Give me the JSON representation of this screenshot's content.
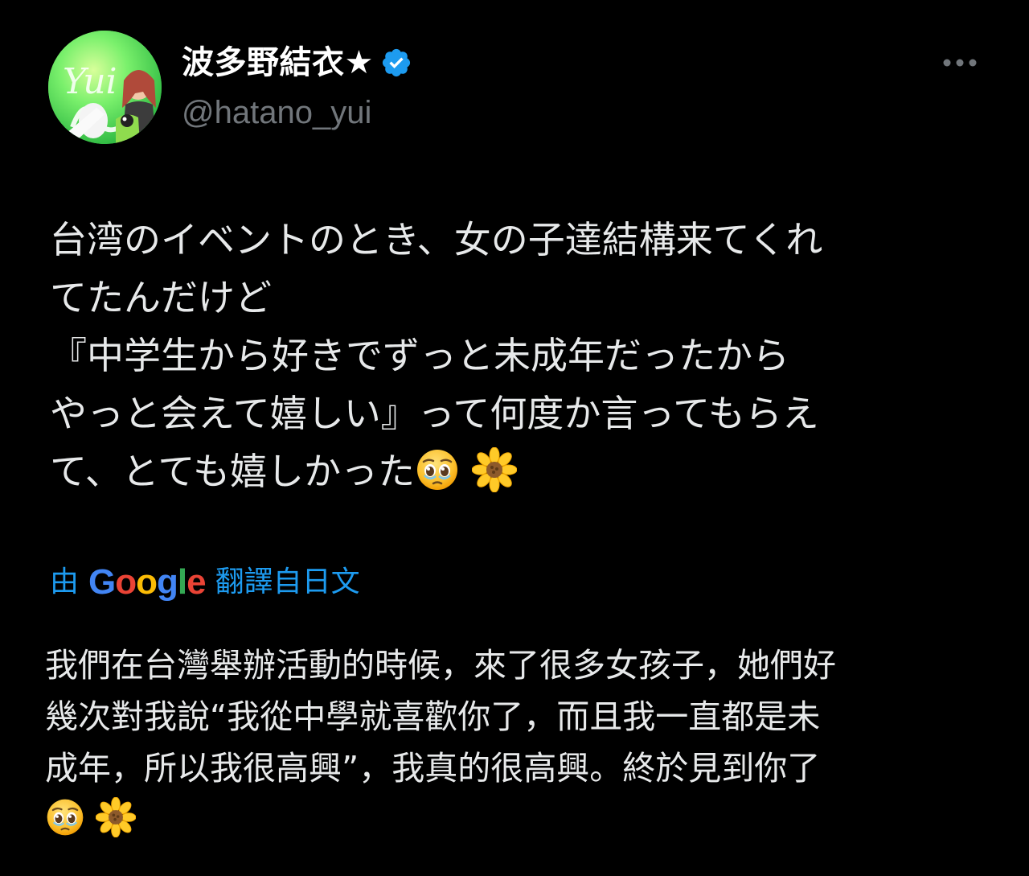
{
  "author": {
    "display_name": "波多野結衣★",
    "handle": "@hatano_yui",
    "avatar_text": "Yui",
    "verified": true
  },
  "tweet": {
    "lines": [
      "台湾のイベントのとき、女の子達結構来てくれ",
      "てたんだけど",
      "『中学生から好きでずっと未成年だったから",
      "やっと会えて嬉しい』って何度か言ってもらえ",
      "て、とても嬉しかった"
    ],
    "emojis": [
      "pleading-face",
      "sunflower"
    ]
  },
  "translation": {
    "prefix": "由",
    "provider": "Google",
    "suffix": "翻譯自日文",
    "lines": [
      "我們在台灣舉辦活動的時候，來了很多女孩子，她們好",
      "幾次對我說“我從中學就喜歡你了，而且我一直都是未",
      "成年，所以我很高興”，我真的很高興。終於見到你了"
    ],
    "emojis": [
      "pleading-face",
      "sunflower"
    ]
  },
  "icons": {
    "verified": "verified-badge-icon",
    "more": "more-options-icon"
  },
  "colors": {
    "background": "#000000",
    "text": "#e7e9ea",
    "secondary_text": "#71767b",
    "link": "#1d9bf0",
    "verified": "#1d9bf0"
  }
}
